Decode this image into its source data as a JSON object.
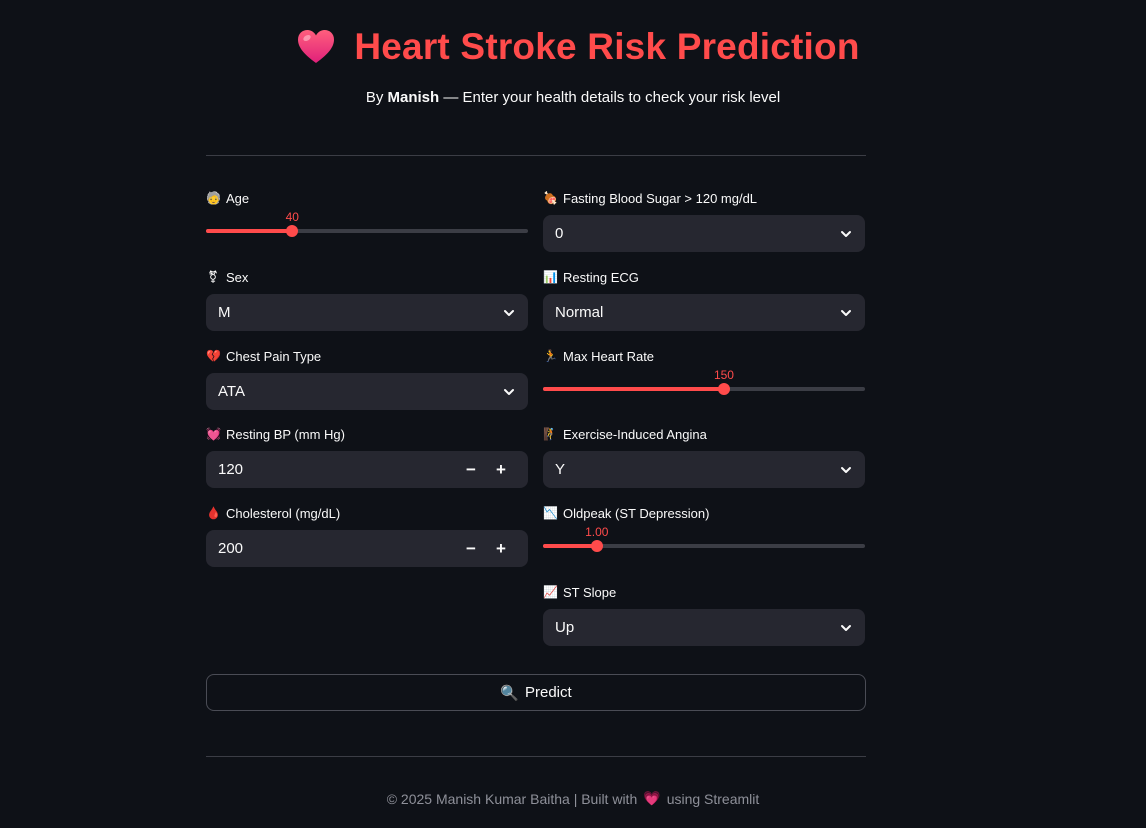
{
  "header": {
    "title": "Heart Stroke Risk Prediction",
    "subtitle_prefix": "By",
    "author": "Manish",
    "subtitle_suffix": "— Enter your health details to check your risk level"
  },
  "colors": {
    "accent": "#ff4b4b",
    "background": "#0e1117",
    "input_bg": "#262730"
  },
  "form": {
    "age": {
      "label": "Age",
      "icon": "person-face-icon",
      "emoji": "🧓",
      "value": "40",
      "min": 18,
      "max": 100,
      "fraction": 0.268
    },
    "fasting_bs": {
      "label": "Fasting Blood Sugar > 120 mg/dL",
      "icon": "meat-icon",
      "emoji": "🍖",
      "value": "0"
    },
    "sex": {
      "label": "Sex",
      "icon": "gender-icon",
      "emoji": "⚧",
      "value": "M"
    },
    "resting_ecg": {
      "label": "Resting ECG",
      "icon": "bar-chart-icon",
      "emoji": "📊",
      "value": "Normal"
    },
    "chest_pain": {
      "label": "Chest Pain Type",
      "icon": "broken-heart-icon",
      "emoji": "💔",
      "value": "ATA"
    },
    "max_hr": {
      "label": "Max Heart Rate",
      "icon": "runner-icon",
      "emoji": "🏃",
      "value": "150",
      "fraction": 0.562
    },
    "resting_bp": {
      "label": "Resting BP (mm Hg)",
      "icon": "growing-heart-icon",
      "emoji": "💓",
      "value": "120"
    },
    "exercise_angina": {
      "label": "Exercise-Induced Angina",
      "icon": "climber-icon",
      "emoji": "🧗",
      "value": "Y"
    },
    "cholesterol": {
      "label": "Cholesterol (mg/dL)",
      "icon": "drop-icon",
      "emoji": "🩸",
      "value": "200"
    },
    "oldpeak": {
      "label": "Oldpeak (ST Depression)",
      "icon": "chart-decreasing-icon",
      "emoji": "📉",
      "value": "1.00",
      "fraction": 0.167
    },
    "st_slope": {
      "label": "ST Slope",
      "icon": "chart-increasing-icon",
      "emoji": "📈",
      "value": "Up"
    }
  },
  "predict_button": {
    "label": "Predict",
    "icon": "magnifier-icon",
    "emoji": "🔍"
  },
  "footer": {
    "left": "© 2025 Manish Kumar Baitha | Built with",
    "emoji": "💗",
    "right": "using Streamlit"
  }
}
